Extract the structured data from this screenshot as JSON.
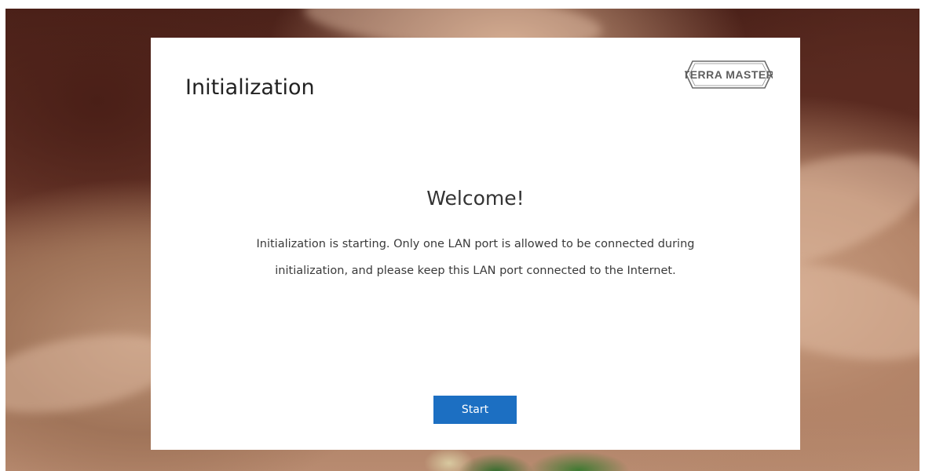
{
  "dialog": {
    "title": "Initialization",
    "logo_text": "TERRA MASTER",
    "heading": "Welcome!",
    "message_line1": "Initialization is starting. Only one LAN port is allowed to be connected during",
    "message_line2": "initialization, and please keep this LAN port connected to the Internet.",
    "start_label": "Start"
  },
  "colors": {
    "accent": "#1c6fc2",
    "dialog_background": "#ffffff"
  },
  "icons": {
    "logo": "terramaster-logo"
  }
}
